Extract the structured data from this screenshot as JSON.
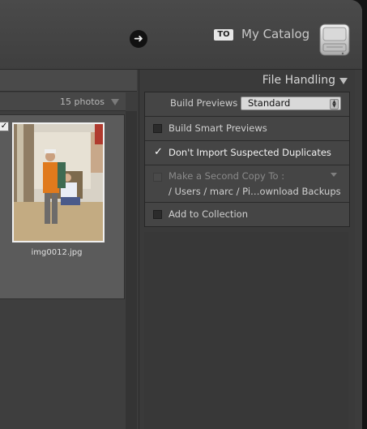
{
  "header": {
    "to_badge": "TO",
    "catalog_name": "My Catalog"
  },
  "grid": {
    "photo_count": "15 photos",
    "thumbnails": [
      {
        "filename": "img0012.jpg",
        "checked": true
      }
    ]
  },
  "file_handling": {
    "title": "File Handling",
    "build_previews_label": "Build Previews",
    "build_previews_value": "Standard",
    "options": {
      "smart_previews": {
        "label": "Build Smart Previews",
        "checked": false
      },
      "no_duplicates": {
        "label": "Don't Import Suspected Duplicates",
        "checked": true
      },
      "second_copy": {
        "label": "Make a Second Copy To :",
        "path": "/ Users / marc / Pi…ownload Backups",
        "checked": false,
        "enabled": false
      },
      "add_to_collection": {
        "label": "Add to Collection",
        "checked": false
      }
    }
  },
  "icons": {
    "forward": "arrow-right-icon",
    "drive": "hard-drive-icon",
    "checkmark": "checkmark-icon",
    "disclosure": "triangle-down-icon"
  }
}
